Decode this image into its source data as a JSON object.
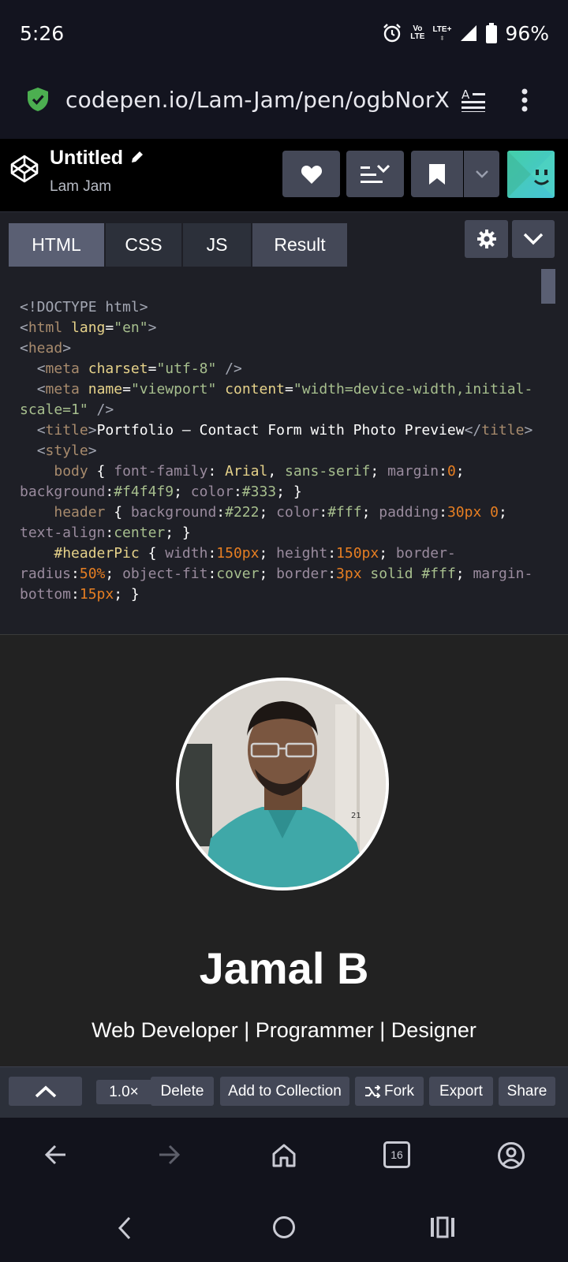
{
  "status_bar": {
    "time": "5:26",
    "volte_line1": "Vo",
    "volte_line2": "LTE",
    "lte": "LTE+",
    "battery": "96%"
  },
  "browser": {
    "url": "codepen.io/Lam-Jam/pen/ogbNorX",
    "tab_count": "16"
  },
  "pen_header": {
    "title": "Untitled",
    "author": "Lam Jam"
  },
  "editor": {
    "tabs": [
      "HTML",
      "CSS",
      "JS",
      "Result"
    ],
    "code_lines": [
      "<!DOCTYPE html>",
      "<html lang=\"en\">",
      "<head>",
      "  <meta charset=\"utf-8\" />",
      "  <meta name=\"viewport\" content=\"width=device-width,initial-scale=1\" />",
      "  <title>Portfolio — Contact Form with Photo Preview</title>",
      "  <style>",
      "    body { font-family: Arial, sans-serif; margin:0; background:#f4f4f9; color:#333; }",
      "    header { background:#222; color:#fff; padding:30px 0; text-align:center; }",
      "    #headerPic { width:150px; height:150px; border-radius:50%; object-fit:cover; border:3px solid #fff; margin-bottom:15px; }"
    ]
  },
  "result": {
    "name": "Jamal B",
    "role": "Web Developer | Programmer | Designer",
    "photo_badge": "21"
  },
  "toolbar": {
    "zoom": "1.0×",
    "delete": "Delete",
    "add_to_collection": "Add to Collection",
    "fork": "Fork",
    "export": "Export",
    "share": "Share"
  },
  "colors": {
    "codepen_button": "#444857",
    "shield_green": "#4caf50",
    "avatar_teal": "#44d0a8"
  }
}
